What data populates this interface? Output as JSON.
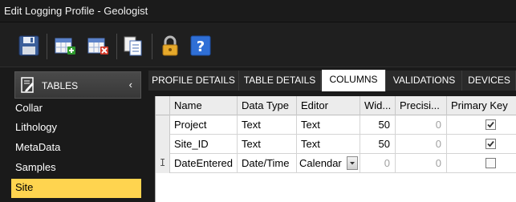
{
  "window": {
    "title": "Edit Logging Profile - Geologist"
  },
  "toolbar": {
    "buttons": [
      {
        "name": "save",
        "icon": "floppy-disk-icon"
      },
      {
        "name": "add-table",
        "icon": "table-add-icon"
      },
      {
        "name": "delete-table",
        "icon": "table-delete-icon"
      },
      {
        "name": "copy",
        "icon": "copy-pages-icon"
      },
      {
        "name": "lock",
        "icon": "padlock-icon"
      },
      {
        "name": "help",
        "icon": "question-mark-icon"
      }
    ]
  },
  "sidebar": {
    "header": {
      "label": "TABLES",
      "chevron": "‹"
    },
    "items": [
      {
        "label": "Collar",
        "selected": false
      },
      {
        "label": "Lithology",
        "selected": false
      },
      {
        "label": "MetaData",
        "selected": false
      },
      {
        "label": "Samples",
        "selected": false
      },
      {
        "label": "Site",
        "selected": true
      }
    ]
  },
  "tabs": [
    {
      "label": "PROFILE DETAILS",
      "active": false
    },
    {
      "label": "TABLE DETAILS",
      "active": false
    },
    {
      "label": "COLUMNS",
      "active": true
    },
    {
      "label": "VALIDATIONS",
      "active": false
    },
    {
      "label": "DEVICES",
      "active": false
    }
  ],
  "grid": {
    "columns": [
      "Name",
      "Data Type",
      "Editor",
      "Wid...",
      "Precisi...",
      "Primary Key"
    ],
    "rows": [
      {
        "name": "Project",
        "data_type": "Text",
        "editor": "Text",
        "width": "50",
        "precision": "0",
        "primary_key": true
      },
      {
        "name": "Site_ID",
        "data_type": "Text",
        "editor": "Text",
        "width": "50",
        "precision": "0",
        "primary_key": true
      },
      {
        "name": "DateEntered",
        "data_type": "Date/Time",
        "editor": "Calendar",
        "width": "0",
        "precision": "0",
        "primary_key": false
      }
    ],
    "editing_indicator": "I"
  },
  "colors": {
    "selection": "#ffd44f",
    "background": "#1a1a1a",
    "active_tab": "#ffffff"
  }
}
